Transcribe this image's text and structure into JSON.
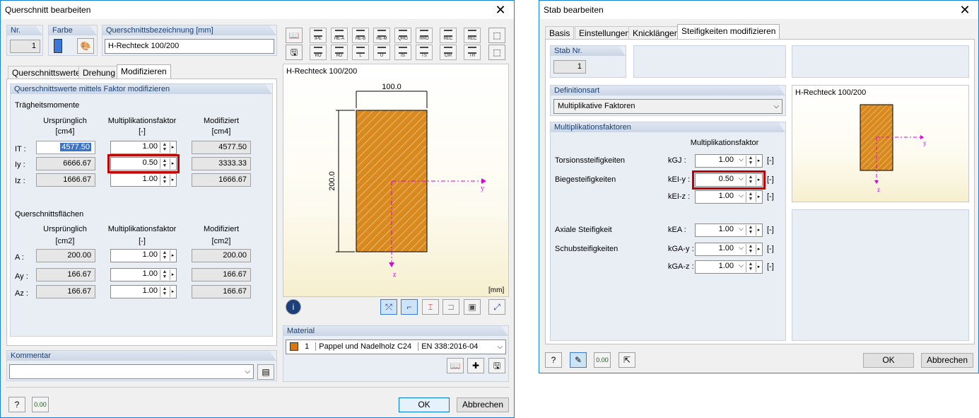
{
  "left": {
    "title": "Querschnitt bearbeiten",
    "nr_label": "Nr.",
    "nr_value": "1",
    "farbe_label": "Farbe",
    "bez_label": "Querschnittsbezeichnung [mm]",
    "bez_value": "H-Rechteck 100/200",
    "tabs": [
      "Querschnittswerte",
      "Drehung",
      "Modifizieren"
    ],
    "panel_header": "Querschnittswerte mittels Faktor modifizieren",
    "traeg_title": "Trägheitsmomente",
    "col_orig": "Ursprünglich",
    "col_fac": "Multiplikationsfaktor",
    "col_mod": "Modifiziert",
    "unit_i": "[cm4]",
    "unit_a": "[cm2]",
    "unit_fac": "[-]",
    "i_rows": [
      {
        "label": "IT :",
        "orig": "4577.50",
        "fac": "1.00",
        "mod": "4577.50"
      },
      {
        "label": "Iy :",
        "orig": "6666.67",
        "fac": "0.50",
        "mod": "3333.33"
      },
      {
        "label": "Iz :",
        "orig": "1666.67",
        "fac": "1.00",
        "mod": "1666.67"
      }
    ],
    "flaech_title": "Querschnittsflächen",
    "a_rows": [
      {
        "label": "A :",
        "orig": "200.00",
        "fac": "1.00",
        "mod": "200.00"
      },
      {
        "label": "Ay :",
        "orig": "166.67",
        "fac": "1.00",
        "mod": "166.67"
      },
      {
        "label": "Az :",
        "orig": "166.67",
        "fac": "1.00",
        "mod": "166.67"
      }
    ],
    "kommentar_label": "Kommentar",
    "toolbar": [
      "IPE",
      "HE-A",
      "HE-B",
      "HE-M",
      "QRO",
      "RRO",
      "REC",
      "REC",
      "RO",
      "RD",
      "L",
      "U",
      "IS",
      "TS",
      "CIR",
      "TH"
    ],
    "preview_title": "H-Rechteck 100/200",
    "dim_width": "100.0",
    "dim_height": "200.0",
    "axis_y": "y",
    "axis_z": "z",
    "unit_mm": "[mm]",
    "material_label": "Material",
    "material_nr": "1",
    "material_name": "Pappel und Nadelholz C24",
    "material_norm": "EN 338:2016-04",
    "ok": "OK",
    "cancel": "Abbrechen"
  },
  "right": {
    "title": "Stab bearbeiten",
    "tabs": [
      "Basis",
      "Einstellungen",
      "Knicklängen",
      "Steifigkeiten modifizieren"
    ],
    "stab_label": "Stab Nr.",
    "stab_value": "1",
    "defart_label": "Definitionsart",
    "defart_value": "Multiplikative Faktoren",
    "mult_label": "Multiplikationsfaktoren",
    "mult_col": "Multiplikationsfaktor",
    "rows": [
      {
        "label": "Torsionssteifigkeiten",
        "sym": "kGJ :",
        "val": "1.00",
        "unit": "[-]"
      },
      {
        "label": "Biegesteifigkeiten",
        "sym": "kEI-y :",
        "val": "0.50",
        "unit": "[-]"
      },
      {
        "label": "",
        "sym": "kEI-z :",
        "val": "1.00",
        "unit": "[-]"
      },
      {
        "label": "Axiale Steifigkeit",
        "sym": "kEA :",
        "val": "1.00",
        "unit": "[-]"
      },
      {
        "label": "Schubsteifigkeiten",
        "sym": "kGA-y :",
        "val": "1.00",
        "unit": "[-]"
      },
      {
        "label": "",
        "sym": "kGA-z :",
        "val": "1.00",
        "unit": "[-]"
      }
    ],
    "preview_title": "H-Rechteck 100/200",
    "axis_y": "y",
    "axis_z": "z",
    "ok": "OK",
    "cancel": "Abbrechen"
  },
  "colors": {
    "accent": "#1783d8",
    "wood": "#d98a1f",
    "highlight": "#c00000",
    "axis": "#e000e0"
  }
}
